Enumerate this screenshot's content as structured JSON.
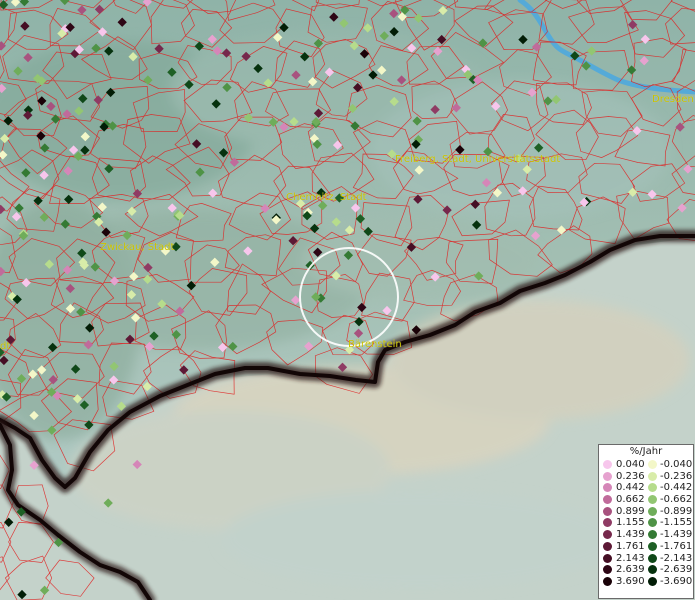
{
  "map": {
    "places": [
      {
        "name": "Dresden"
      },
      {
        "name": "Freiberg, Stadt, Universitätsstadt"
      },
      {
        "name": "Chemnitz, Stadt"
      },
      {
        "name": "Zwickau, Stadt"
      },
      {
        "name": "Bärenstein"
      },
      {
        "name": "dt"
      }
    ],
    "colors": {
      "water": "#55aad8",
      "boundary": "#e02020",
      "border": "#1a0a0a",
      "selection_circle": "#ffffff"
    }
  },
  "legend": {
    "title": "%/Jahr",
    "positive": [
      {
        "label": "0.040",
        "color": "#f7c6ec"
      },
      {
        "label": "0.236",
        "color": "#e6a2cf"
      },
      {
        "label": "0.442",
        "color": "#d586b8"
      },
      {
        "label": "0.662",
        "color": "#c06b9b"
      },
      {
        "label": "0.899",
        "color": "#a8527f"
      },
      {
        "label": "1.155",
        "color": "#8f3b64"
      },
      {
        "label": "1.439",
        "color": "#76284c"
      },
      {
        "label": "1.761",
        "color": "#5d1936"
      },
      {
        "label": "2.143",
        "color": "#450e24"
      },
      {
        "label": "2.639",
        "color": "#2e0615"
      },
      {
        "label": "3.690",
        "color": "#1a0208"
      }
    ],
    "negative": [
      {
        "label": "-0.040",
        "color": "#f3f7c8"
      },
      {
        "label": "-0.236",
        "color": "#d8eca9"
      },
      {
        "label": "-0.442",
        "color": "#b6dc8c"
      },
      {
        "label": "-0.662",
        "color": "#92c672"
      },
      {
        "label": "-0.899",
        "color": "#6fad5a"
      },
      {
        "label": "-1.155",
        "color": "#4f9346"
      },
      {
        "label": "-1.439",
        "color": "#347a34"
      },
      {
        "label": "-1.761",
        "color": "#1e6025"
      },
      {
        "label": "-2.143",
        "color": "#0f4818"
      },
      {
        "label": "-2.639",
        "color": "#06320e"
      },
      {
        "label": "-3.690",
        "color": "#021d06"
      }
    ]
  }
}
